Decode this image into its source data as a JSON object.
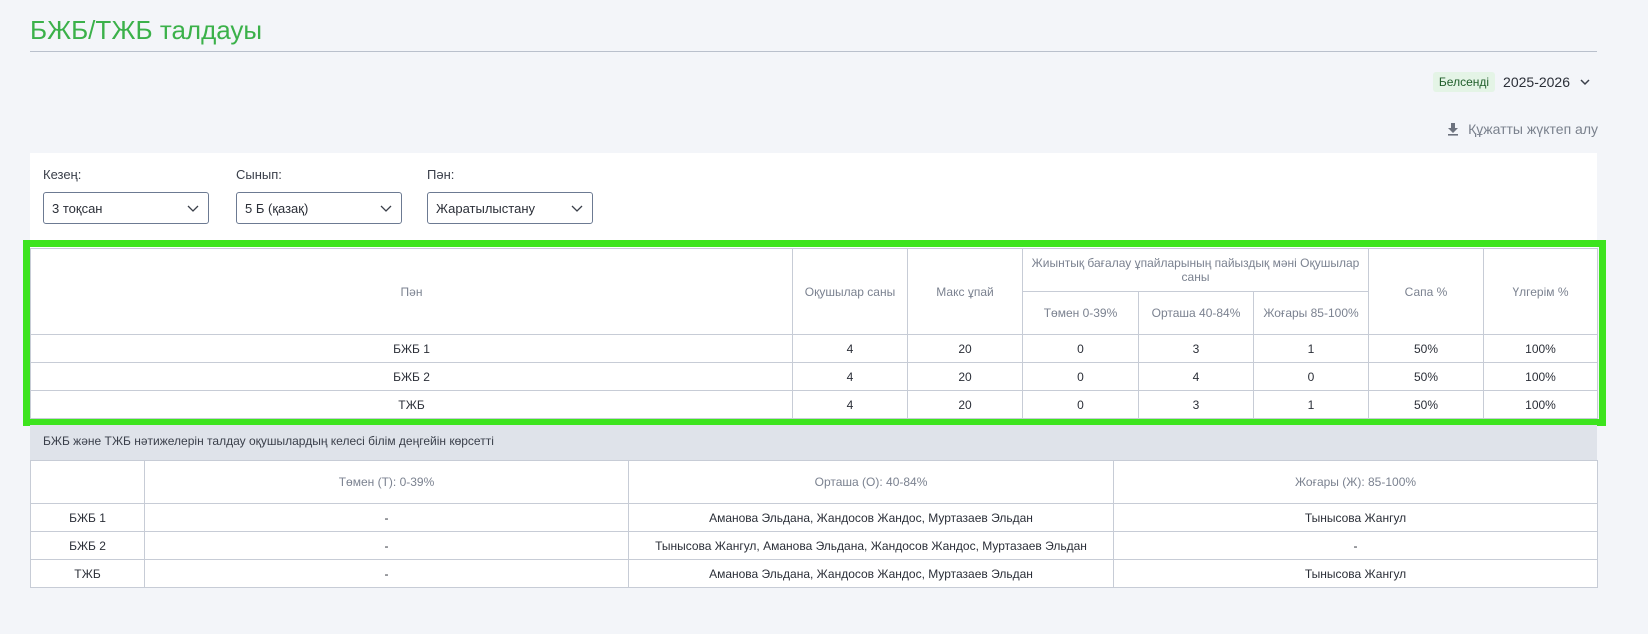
{
  "page_title": "БЖБ/ТЖБ талдауы",
  "year_selector": {
    "badge": "Белсенді",
    "value": "2025-2026"
  },
  "download_label": "Құжатты жүктеп алу",
  "filters": {
    "period": {
      "label": "Кезең:",
      "value": "3 тоқсан"
    },
    "class": {
      "label": "Сынып:",
      "value": "5 Б (қазақ)"
    },
    "subject": {
      "label": "Пән:",
      "value": "Жаратылыстану"
    }
  },
  "summary_table": {
    "headers": {
      "subject": "Пән",
      "students": "Оқушылар саны",
      "max_score": "Макс ұпай",
      "group_title": "Жиынтық бағалау ұпайларының пайыздық мәні Оқушылар саны",
      "low": "Төмен 0-39%",
      "mid": "Орташа 40-84%",
      "high": "Жоғары 85-100%",
      "quality": "Сапа %",
      "progress": "Үлгерім %"
    },
    "rows": [
      {
        "name": "БЖБ 1",
        "students": "4",
        "max": "20",
        "low": "0",
        "mid": "3",
        "high": "1",
        "quality": "50%",
        "progress": "100%"
      },
      {
        "name": "БЖБ 2",
        "students": "4",
        "max": "20",
        "low": "0",
        "mid": "4",
        "high": "0",
        "quality": "50%",
        "progress": "100%"
      },
      {
        "name": "ТЖБ",
        "students": "4",
        "max": "20",
        "low": "0",
        "mid": "3",
        "high": "1",
        "quality": "50%",
        "progress": "100%"
      }
    ]
  },
  "note": "БЖБ және ТЖБ нәтижелерін талдау оқушылардың келесі білім деңгейін көрсетті",
  "levels_table": {
    "headers": {
      "blank": "",
      "low": "Төмен (Т): 0-39%",
      "mid": "Орташа (О): 40-84%",
      "high": "Жоғары (Ж): 85-100%"
    },
    "rows": [
      {
        "name": "БЖБ 1",
        "low": "-",
        "mid": "Аманова Эльдана, Жандосов Жандос, Муртазаев Эльдан",
        "high": "Тынысова Жангул"
      },
      {
        "name": "БЖБ 2",
        "low": "-",
        "mid": "Тынысова Жангул, Аманова Эльдана, Жандосов Жандос, Муртазаев Эльдан",
        "high": "-"
      },
      {
        "name": "ТЖБ",
        "low": "-",
        "mid": "Аманова Эльдана, Жандосов Жандос, Муртазаев Эльдан",
        "high": "Тынысова Жангул"
      }
    ]
  }
}
